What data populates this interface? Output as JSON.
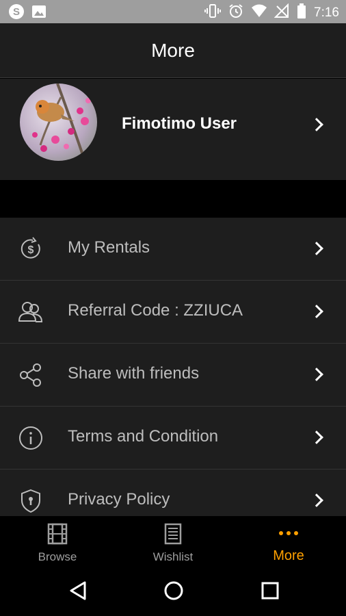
{
  "status_bar": {
    "time": "7:16",
    "left_icons": [
      "skype-icon",
      "image-icon"
    ],
    "right_icons": [
      "vibrate-icon",
      "alarm-icon",
      "wifi-icon",
      "no-signal-icon",
      "battery-icon"
    ]
  },
  "header": {
    "title": "More"
  },
  "profile": {
    "name": "Fimotimo User"
  },
  "menu": {
    "items": [
      {
        "label": "My Rentals",
        "icon": "rental-money-icon"
      },
      {
        "label": "Referral Code : ZZIUCA",
        "icon": "referral-users-icon"
      },
      {
        "label": "Share with friends",
        "icon": "share-icon"
      },
      {
        "label": "Terms and Condition",
        "icon": "info-icon"
      },
      {
        "label": "Privacy Policy",
        "icon": "shield-lock-icon"
      }
    ]
  },
  "bottom_nav": {
    "tabs": [
      {
        "label": "Browse",
        "icon": "film-icon"
      },
      {
        "label": "Wishlist",
        "icon": "list-icon"
      },
      {
        "label": "More",
        "icon": "more-dots-icon"
      }
    ],
    "active": "More",
    "accent_color": "#ffa000"
  },
  "system_nav": {
    "buttons": [
      "back-icon",
      "home-icon",
      "recents-icon"
    ]
  }
}
